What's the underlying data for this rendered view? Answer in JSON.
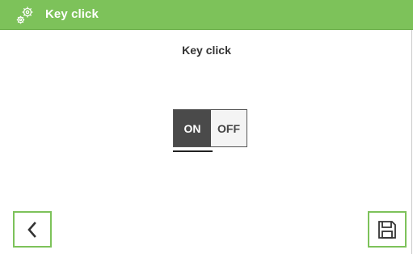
{
  "header": {
    "title": "Key click",
    "icon": "gears-icon",
    "background_color": "#7dc25a"
  },
  "main": {
    "heading": "Key click",
    "toggle": {
      "on_label": "ON",
      "off_label": "OFF",
      "selected": "ON"
    }
  },
  "footer": {
    "back_icon": "chevron-left-icon",
    "save_icon": "floppy-disk-icon"
  }
}
